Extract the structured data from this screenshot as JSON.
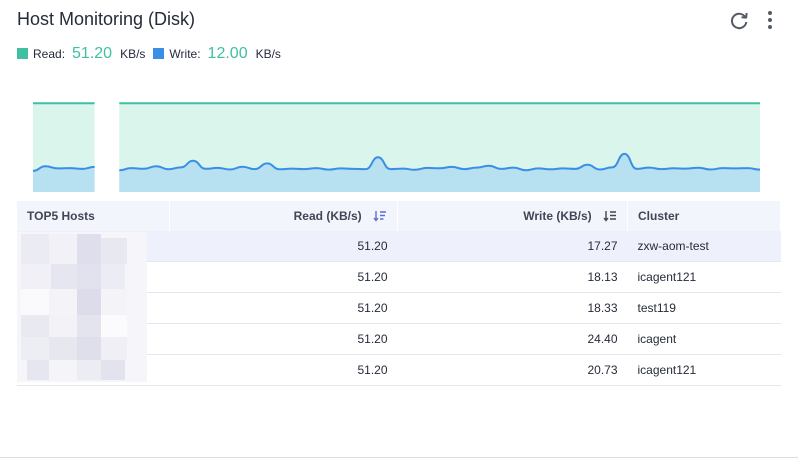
{
  "header": {
    "title": "Host Monitoring (Disk)",
    "refresh_icon": "refresh-icon",
    "more_icon": "more-vertical-icon"
  },
  "legend": {
    "read_label": "Read:",
    "read_value": "51.20",
    "read_unit": "KB/s",
    "read_color": "#3fc0a0",
    "write_label": "Write:",
    "write_value": "12.00",
    "write_unit": "KB/s",
    "write_color": "#3a8ee6"
  },
  "chart_data": {
    "type": "area",
    "series": [
      {
        "name": "Read",
        "color": "#3fc0a0",
        "values": [
          51.2,
          51.2,
          51.2,
          51.2,
          51.2,
          51.2,
          null,
          51.2,
          51.2,
          51.2,
          51.2,
          51.2,
          51.2,
          51.2,
          51.2,
          51.2,
          51.2,
          51.2,
          51.2,
          51.2,
          51.2,
          51.2,
          51.2,
          51.2,
          51.2,
          51.2,
          51.2,
          51.2,
          51.2,
          51.2,
          51.2,
          51.2,
          51.2,
          51.2,
          51.2,
          51.2,
          51.2,
          51.2,
          51.2,
          51.2,
          51.2,
          51.2,
          51.2,
          51.2,
          51.2,
          51.2,
          51.2,
          51.2,
          51.2,
          51.2,
          51.2,
          51.2,
          51.2,
          51.2,
          51.2,
          51.2,
          51.2,
          51.2,
          51.2,
          51.2
        ]
      },
      {
        "name": "Write",
        "color": "#3a8ee6",
        "values": [
          12.2,
          14.8,
          13.6,
          13.8,
          13.3,
          14.5,
          null,
          12.6,
          13.8,
          13.4,
          14.9,
          13.1,
          14.2,
          18.0,
          13.4,
          13.9,
          13.0,
          14.6,
          13.2,
          16.5,
          13.1,
          13.5,
          13.2,
          13.8,
          12.9,
          13.6,
          13.3,
          13.2,
          20.0,
          13.2,
          13.5,
          12.8,
          13.9,
          13.7,
          14.5,
          13.2,
          14.1,
          15.1,
          13.3,
          14.1,
          12.6,
          13.6,
          13.1,
          13.6,
          13.3,
          15.7,
          13.0,
          14.2,
          22.0,
          13.3,
          14.1,
          13.2,
          13.7,
          13.5,
          14.0,
          13.0,
          13.8,
          13.6,
          13.8,
          12.9
        ]
      }
    ],
    "ylim": [
      0,
      60
    ],
    "grid": false
  },
  "table": {
    "headers": {
      "host": "TOP5 Hosts",
      "read": "Read (KB/s)",
      "write": "Write (KB/s)",
      "cluster": "Cluster"
    },
    "sort_icon": "sort-descending-icon",
    "rows": [
      {
        "host": "",
        "read": "51.20",
        "write": "17.27",
        "cluster": "zxw-aom-test"
      },
      {
        "host": "",
        "read": "51.20",
        "write": "18.13",
        "cluster": "icagent121"
      },
      {
        "host": "",
        "read": "51.20",
        "write": "18.33",
        "cluster": "test119"
      },
      {
        "host": "",
        "read": "51.20",
        "write": "24.40",
        "cluster": "icagent"
      },
      {
        "host": "",
        "read": "51.20",
        "write": "20.73",
        "cluster": "icagent121"
      }
    ]
  }
}
